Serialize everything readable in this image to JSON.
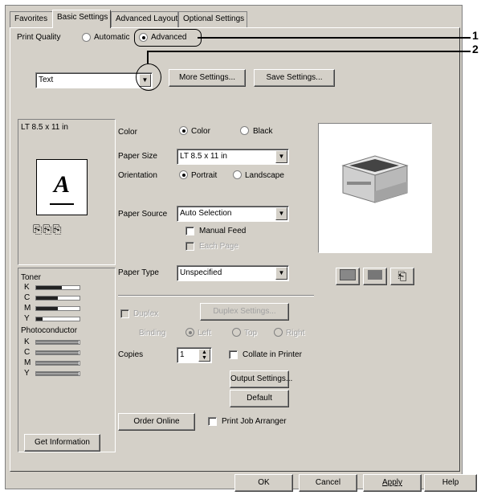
{
  "tabs": [
    "Favorites",
    "Basic Settings",
    "Advanced Layout",
    "Optional Settings"
  ],
  "print_quality": {
    "label": "Print Quality",
    "automatic": "Automatic",
    "advanced": "Advanced",
    "selected": "Advanced",
    "preset_value": "Text",
    "more_settings": "More Settings...",
    "save_settings": "Save Settings..."
  },
  "preview": {
    "paper_label": "LT 8.5 x 11 in",
    "page_letter": "A"
  },
  "status": {
    "toner_label": "Toner",
    "toner": [
      {
        "k": "K",
        "level": 0.6
      },
      {
        "k": "C",
        "level": 0.5
      },
      {
        "k": "M",
        "level": 0.5
      },
      {
        "k": "Y",
        "level": 0.15
      }
    ],
    "photoconductor_label": "Photoconductor",
    "photoconductor": [
      {
        "k": "K",
        "level": 0.98
      },
      {
        "k": "C",
        "level": 0.98
      },
      {
        "k": "M",
        "level": 0.98
      },
      {
        "k": "Y",
        "level": 0.98
      }
    ],
    "get_information": "Get Information"
  },
  "settings": {
    "color_label": "Color",
    "color_option": "Color",
    "black_option": "Black",
    "color_selected": "Color",
    "paper_size_label": "Paper Size",
    "paper_size_value": "LT 8.5 x 11 in",
    "orientation_label": "Orientation",
    "portrait": "Portrait",
    "landscape": "Landscape",
    "orientation_selected": "Portrait",
    "paper_source_label": "Paper Source",
    "paper_source_value": "Auto Selection",
    "manual_feed": "Manual Feed",
    "each_page": "Each Page",
    "paper_type_label": "Paper Type",
    "paper_type_value": "Unspecified",
    "duplex": "Duplex",
    "duplex_settings": "Duplex Settings...",
    "binding_label": "Binding",
    "left": "Left",
    "top": "Top",
    "right": "Right",
    "copies_label": "Copies",
    "copies_value": "1",
    "collate": "Collate in Printer",
    "output_settings": "Output Settings...",
    "default": "Default",
    "order_online": "Order Online",
    "print_job_arranger": "Print Job Arranger"
  },
  "footer": {
    "ok": "OK",
    "cancel": "Cancel",
    "apply": "Apply",
    "help": "Help"
  },
  "callouts": [
    "1",
    "2"
  ]
}
